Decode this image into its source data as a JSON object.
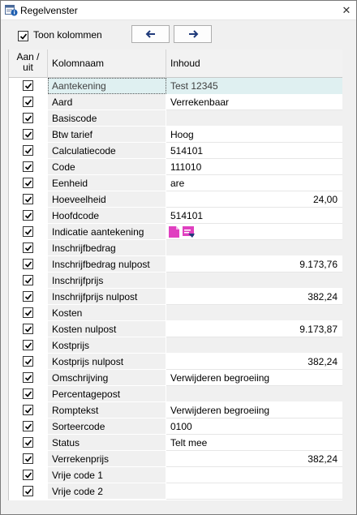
{
  "window": {
    "title": "Regelvenster",
    "icon": "window-info-icon",
    "close_glyph": "✕"
  },
  "toolbar": {
    "show_columns_label": "Toon kolommen",
    "show_columns_checked": true,
    "prev_icon": "arrow-left-icon",
    "next_icon": "arrow-right-icon"
  },
  "grid": {
    "headers": {
      "aan_uit_line1": "Aan /",
      "aan_uit_line2": "uit",
      "kolomnaam": "Kolomnaam",
      "inhoud": "Inhoud"
    },
    "rows": [
      {
        "name": "Aantekening",
        "value": "Test 12345",
        "checked": true,
        "selected": true
      },
      {
        "name": "Aard",
        "value": "Verrekenbaar",
        "checked": true
      },
      {
        "name": "Basiscode",
        "value": "",
        "checked": true
      },
      {
        "name": "Btw tarief",
        "value": "Hoog",
        "checked": true
      },
      {
        "name": "Calculatiecode",
        "value": "514101",
        "checked": true
      },
      {
        "name": "Code",
        "value": "111010",
        "checked": true
      },
      {
        "name": "Eenheid",
        "value": "are",
        "checked": true
      },
      {
        "name": "Hoeveelheid",
        "value": "24,00",
        "checked": true,
        "numeric": true
      },
      {
        "name": "Hoofdcode",
        "value": "514101",
        "checked": true
      },
      {
        "name": "Indicatie aantekening",
        "value": "",
        "checked": true,
        "icons": [
          "note-icon",
          "note-edit-icon"
        ]
      },
      {
        "name": "Inschrijfbedrag",
        "value": "",
        "checked": true
      },
      {
        "name": "Inschrijfbedrag nulpost",
        "value": "9.173,76",
        "checked": true,
        "numeric": true
      },
      {
        "name": "Inschrijfprijs",
        "value": "",
        "checked": true
      },
      {
        "name": "Inschrijfprijs nulpost",
        "value": "382,24",
        "checked": true,
        "numeric": true
      },
      {
        "name": "Kosten",
        "value": "",
        "checked": true
      },
      {
        "name": "Kosten nulpost",
        "value": "9.173,87",
        "checked": true,
        "numeric": true
      },
      {
        "name": "Kostprijs",
        "value": "",
        "checked": true
      },
      {
        "name": "Kostprijs nulpost",
        "value": "382,24",
        "checked": true,
        "numeric": true
      },
      {
        "name": "Omschrijving",
        "value": "Verwijderen begroeiing",
        "checked": true
      },
      {
        "name": "Percentagepost",
        "value": "",
        "checked": true
      },
      {
        "name": "Romptekst",
        "value": "Verwijderen begroeiing",
        "checked": true
      },
      {
        "name": "Sorteercode",
        "value": "0100",
        "checked": true
      },
      {
        "name": "Status",
        "value": "Telt mee",
        "checked": true
      },
      {
        "name": "Verrekenprijs",
        "value": "382,24",
        "checked": true,
        "numeric": true
      },
      {
        "name": "Vrije code 1",
        "value": "",
        "checked": true,
        "white": true
      },
      {
        "name": "Vrije code 2",
        "value": "",
        "checked": true,
        "white": true
      }
    ]
  },
  "colors": {
    "selected_row": "#dff0f1",
    "note_icon": "#e040c0"
  }
}
